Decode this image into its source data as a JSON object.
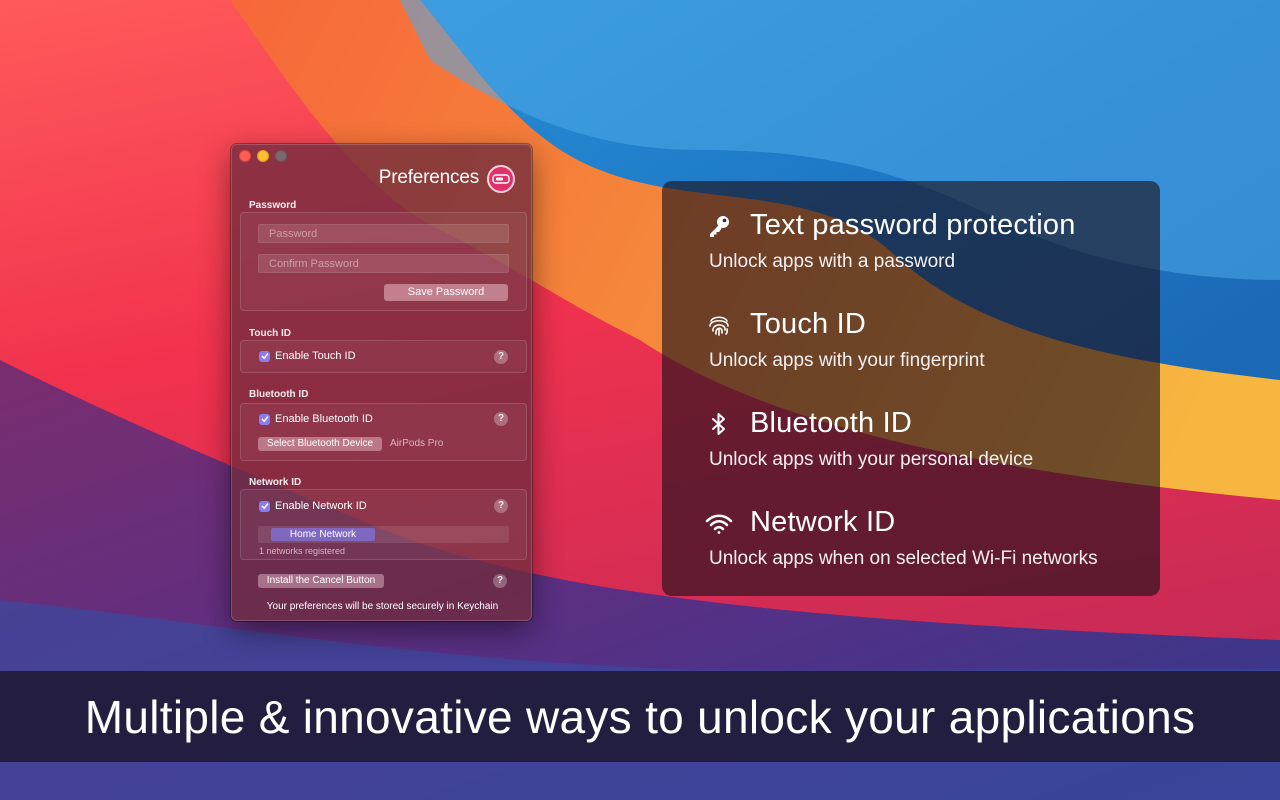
{
  "preferences": {
    "title": "Preferences",
    "password": {
      "label": "Password",
      "password_placeholder": "Password",
      "confirm_placeholder": "Confirm Password",
      "save_button": "Save Password"
    },
    "touch_id": {
      "label": "Touch ID",
      "checkbox_label": "Enable Touch ID",
      "checked": true
    },
    "bluetooth_id": {
      "label": "Bluetooth ID",
      "checkbox_label": "Enable Bluetooth ID",
      "checked": true,
      "select_button": "Select Bluetooth Device",
      "device_name": "AirPods Pro"
    },
    "network_id": {
      "label": "Network ID",
      "checkbox_label": "Enable Network ID",
      "checked": true,
      "networks": [
        "Home Network"
      ],
      "registered_text": "1 networks registered"
    },
    "install_cancel_button": "Install the Cancel Button",
    "help_glyph": "?",
    "footer_note": "Your preferences will be stored securely in Keychain"
  },
  "features": [
    {
      "icon": "key-icon",
      "title": "Text password protection",
      "description": "Unlock apps with a password"
    },
    {
      "icon": "fingerprint-icon",
      "title": "Touch ID",
      "description": "Unlock apps with your fingerprint"
    },
    {
      "icon": "bluetooth-icon",
      "title": "Bluetooth ID",
      "description": "Unlock apps with your personal device"
    },
    {
      "icon": "wifi-icon",
      "title": "Network ID",
      "description": "Unlock apps when on selected Wi-Fi networks"
    }
  ],
  "banner": {
    "text": "Multiple & innovative ways to unlock your applications"
  },
  "colors": {
    "accent": "#e2306a",
    "checkbox": "#8a7cf0",
    "network_pill": "#806cd0"
  }
}
